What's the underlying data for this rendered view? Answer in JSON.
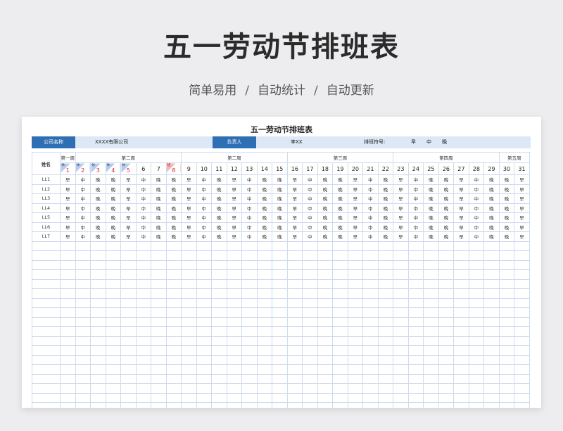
{
  "header": {
    "title": "五一劳动节排班表",
    "subtitle_parts": [
      "简单易用",
      "自动统计",
      "自动更新"
    ],
    "separator": "/"
  },
  "sheet": {
    "title": "五一劳动节排班表",
    "info": {
      "company_label": "公司名称",
      "company_value": "XXXX有限公司",
      "manager_label": "负责人",
      "manager_value": "李XX",
      "symbol_label": "排班符号:",
      "symbols": [
        "早",
        "中",
        "晚"
      ]
    },
    "name_header": "姓名",
    "weeks": [
      {
        "label": "第一周",
        "span": 1
      },
      {
        "label": "第二周",
        "span": 7
      },
      {
        "label": "第二周",
        "span": 7
      },
      {
        "label": "第三周",
        "span": 7
      },
      {
        "label": "第四周",
        "span": 7
      },
      {
        "label": "第五周",
        "span": 2
      }
    ],
    "days": [
      {
        "num": "1",
        "tag": "休",
        "type": "holiday"
      },
      {
        "num": "2",
        "tag": "休",
        "type": "holiday"
      },
      {
        "num": "3",
        "tag": "休",
        "type": "holiday"
      },
      {
        "num": "4",
        "tag": "休",
        "type": "holiday"
      },
      {
        "num": "5",
        "tag": "休",
        "type": "holiday"
      },
      {
        "num": "6"
      },
      {
        "num": "7"
      },
      {
        "num": "8",
        "tag": "班",
        "type": "work"
      },
      {
        "num": "9"
      },
      {
        "num": "10"
      },
      {
        "num": "11"
      },
      {
        "num": "12"
      },
      {
        "num": "13"
      },
      {
        "num": "14"
      },
      {
        "num": "15"
      },
      {
        "num": "16"
      },
      {
        "num": "17"
      },
      {
        "num": "18"
      },
      {
        "num": "19"
      },
      {
        "num": "20"
      },
      {
        "num": "21"
      },
      {
        "num": "22"
      },
      {
        "num": "23"
      },
      {
        "num": "24"
      },
      {
        "num": "25"
      },
      {
        "num": "26"
      },
      {
        "num": "27"
      },
      {
        "num": "28"
      },
      {
        "num": "29"
      },
      {
        "num": "30"
      },
      {
        "num": "31"
      }
    ],
    "rows": [
      {
        "name": "LL1",
        "shifts": [
          "早",
          "中",
          "晚",
          "晚",
          "早",
          "中",
          "晚",
          "晚",
          "早",
          "中",
          "晚",
          "早",
          "中",
          "晚",
          "晚",
          "早",
          "中",
          "晚",
          "晚",
          "早",
          "中",
          "晚",
          "早",
          "中",
          "晚",
          "晚",
          "早",
          "中",
          "晚",
          "晚",
          "早"
        ]
      },
      {
        "name": "LL2",
        "shifts": [
          "早",
          "中",
          "晚",
          "晚",
          "早",
          "中",
          "晚",
          "晚",
          "早",
          "中",
          "晚",
          "早",
          "中",
          "晚",
          "晚",
          "早",
          "中",
          "晚",
          "晚",
          "早",
          "中",
          "晚",
          "早",
          "中",
          "晚",
          "晚",
          "早",
          "中",
          "晚",
          "晚",
          "早"
        ]
      },
      {
        "name": "LL3",
        "shifts": [
          "早",
          "中",
          "晚",
          "晚",
          "早",
          "中",
          "晚",
          "晚",
          "早",
          "中",
          "晚",
          "早",
          "中",
          "晚",
          "晚",
          "早",
          "中",
          "晚",
          "晚",
          "早",
          "中",
          "晚",
          "早",
          "中",
          "晚",
          "晚",
          "早",
          "中",
          "晚",
          "晚",
          "早"
        ]
      },
      {
        "name": "LL4",
        "shifts": [
          "早",
          "中",
          "晚",
          "晚",
          "早",
          "中",
          "晚",
          "晚",
          "早",
          "中",
          "晚",
          "早",
          "中",
          "晚",
          "晚",
          "早",
          "中",
          "晚",
          "晚",
          "早",
          "中",
          "晚",
          "早",
          "中",
          "晚",
          "晚",
          "早",
          "中",
          "晚",
          "晚",
          "早"
        ]
      },
      {
        "name": "LL5",
        "shifts": [
          "早",
          "中",
          "晚",
          "晚",
          "早",
          "中",
          "晚",
          "晚",
          "早",
          "中",
          "晚",
          "早",
          "中",
          "晚",
          "晚",
          "早",
          "中",
          "晚",
          "晚",
          "早",
          "中",
          "晚",
          "早",
          "中",
          "晚",
          "晚",
          "早",
          "中",
          "晚",
          "晚",
          "早"
        ]
      },
      {
        "name": "LL6",
        "shifts": [
          "早",
          "中",
          "晚",
          "晚",
          "早",
          "中",
          "晚",
          "晚",
          "早",
          "中",
          "晚",
          "早",
          "中",
          "晚",
          "晚",
          "早",
          "中",
          "晚",
          "晚",
          "早",
          "中",
          "晚",
          "早",
          "中",
          "晚",
          "晚",
          "早",
          "中",
          "晚",
          "晚",
          "早"
        ]
      },
      {
        "name": "LL7",
        "shifts": [
          "早",
          "中",
          "晚",
          "晚",
          "早",
          "中",
          "晚",
          "晚",
          "早",
          "中",
          "晚",
          "早",
          "中",
          "晚",
          "晚",
          "早",
          "中",
          "晚",
          "晚",
          "早",
          "中",
          "晚",
          "早",
          "中",
          "晚",
          "晚",
          "早",
          "中",
          "晚",
          "晚",
          "早"
        ]
      }
    ],
    "colors": {
      "accent_blue": "#2e6fb4",
      "info_bg": "#dce8f5",
      "grid_line": "#cfdcee",
      "holiday_red": "#e0232d"
    }
  }
}
